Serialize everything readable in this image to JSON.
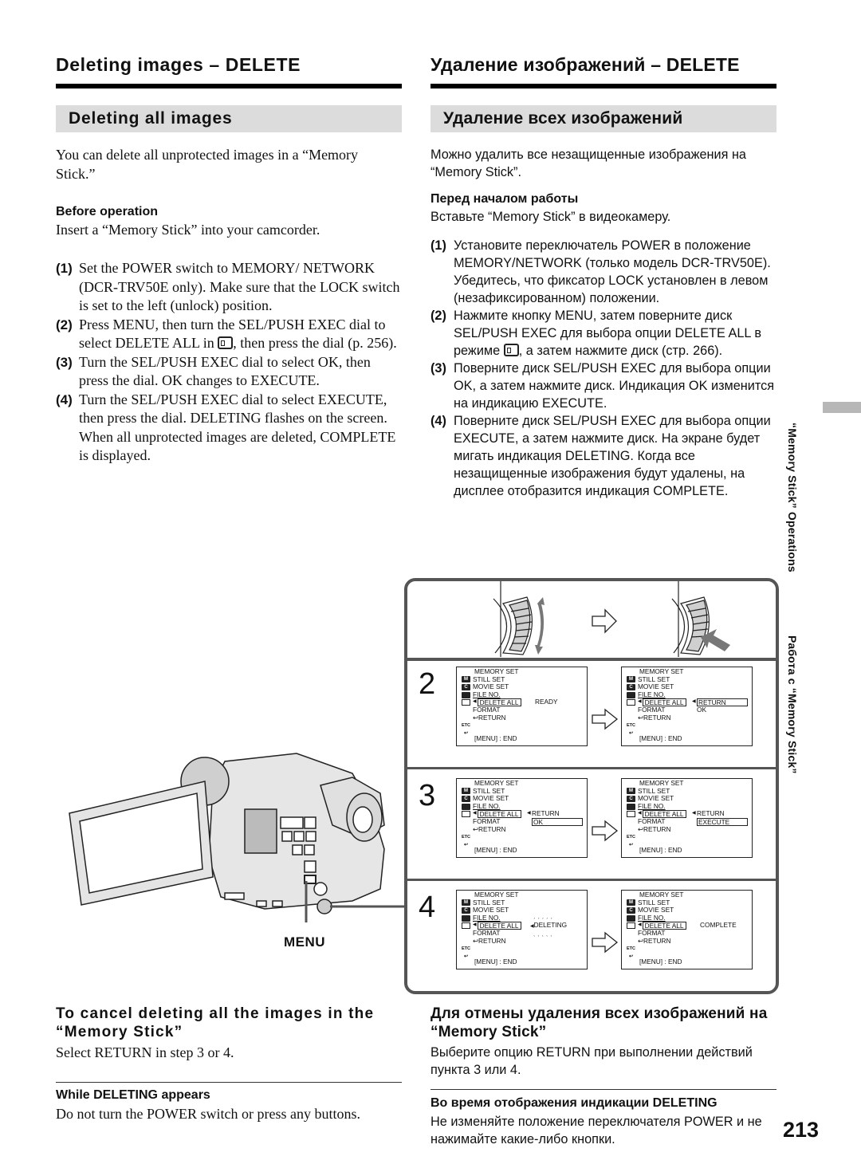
{
  "en": {
    "title": "Deleting images – DELETE",
    "section": "Deleting all images",
    "intro": "You can delete all unprotected images in a “Memory Stick.”",
    "before_heading": "Before operation",
    "before_text": "Insert a “Memory Stick” into your camcorder.",
    "steps": [
      {
        "num": "(1)",
        "text": "Set the POWER switch to MEMORY/ NETWORK (DCR-TRV50E only). Make sure that the LOCK switch is set to the left (unlock) position."
      },
      {
        "num": "(2)",
        "text_before_icon": "Press MENU, then turn the SEL/PUSH EXEC dial to select DELETE ALL in ",
        "text_after_icon": ", then press the dial (p. 256)."
      },
      {
        "num": "(3)",
        "text": "Turn the SEL/PUSH EXEC dial to select OK, then press the dial. OK changes to EXECUTE."
      },
      {
        "num": "(4)",
        "text": "Turn the SEL/PUSH EXEC dial to select EXECUTE, then press the dial. DELETING flashes on the screen. When all unprotected images are deleted, COMPLETE is displayed."
      }
    ],
    "cancel_heading": "To cancel deleting all the images in the “Memory Stick”",
    "cancel_text": "Select RETURN in step 3 or 4.",
    "while_heading": "While DELETING appears",
    "while_text": "Do not turn the POWER switch or press any buttons."
  },
  "ru": {
    "title": "Удаление изображений – DELETE",
    "section": "Удаление всех изображений",
    "intro": "Можно удалить все незащищенные изображения на “Memory Stick”.",
    "before_heading": "Перед началом работы",
    "before_text": "Вставьте “Memory Stick” в видеокамеру.",
    "steps": [
      {
        "num": "(1)",
        "text": "Установите переключатель POWER в положение MEMORY/NETWORK (только модель DCR-TRV50E). Убедитесь, что фиксатор LOCK установлен в левом (незафиксированном) положении."
      },
      {
        "num": "(2)",
        "text_before_icon": "Нажмите кнопку MENU, затем поверните диск SEL/PUSH EXEC для выбора опции DELETE ALL в режиме ",
        "text_after_icon": ", а затем нажмите диск (стр. 266)."
      },
      {
        "num": "(3)",
        "text": "Поверните диск SEL/PUSH EXEC для выбора опции OK, а затем нажмите диск. Индикация OK изменится на индикацию EXECUTE."
      },
      {
        "num": "(4)",
        "text": "Поверните диск SEL/PUSH EXEC для выбора опции EXECUTE, а затем нажмите диск. На экране будет мигать индикация DELETING. Когда все незащищенные изображения будут удалены, на дисплее отобразится индикация COMPLETE."
      }
    ],
    "cancel_heading": "Для отмены удаления всех изображений на “Memory Stick”",
    "cancel_text": "Выберите опцию RETURN при выполнении действий пункта 3 или 4.",
    "while_heading": "Во время отображения индикации DELETING",
    "while_text": "Не изменяйте положение переключателя POWER и не нажимайте какие-либо кнопки."
  },
  "illustration": {
    "menu_callout": "MENU",
    "step_labels": [
      "2",
      "3",
      "4"
    ]
  },
  "menu_screen": {
    "title": "MEMORY SET",
    "items": [
      "STILL SET",
      "MOVIE SET",
      "FILE NO.",
      "DELETE ALL",
      "FORMAT",
      "RETURN"
    ],
    "icons": [
      "M",
      "C",
      "",
      "",
      "",
      "",
      "ETC",
      "↩"
    ],
    "end": "[MENU] : END"
  },
  "screens": {
    "s2a": {
      "status": "READY"
    },
    "s2b": {
      "opt1": "RETURN",
      "opt2": "OK"
    },
    "s3a": {
      "opt1": "RETURN",
      "opt2": "OK"
    },
    "s3b": {
      "opt1": "RETURN",
      "opt2": "EXECUTE"
    },
    "s4a": {
      "status": "DELETING"
    },
    "s4b": {
      "status": "COMPLETE"
    }
  },
  "side_tab": {
    "en": "“Memory Stick” Operations",
    "ru": "Работа с “Memory Stick”"
  },
  "page_number": "213",
  "colors": {
    "section_bar": "#dcdcdc",
    "side_tab": "#b7b7b7",
    "diagram_border": "#555555"
  }
}
